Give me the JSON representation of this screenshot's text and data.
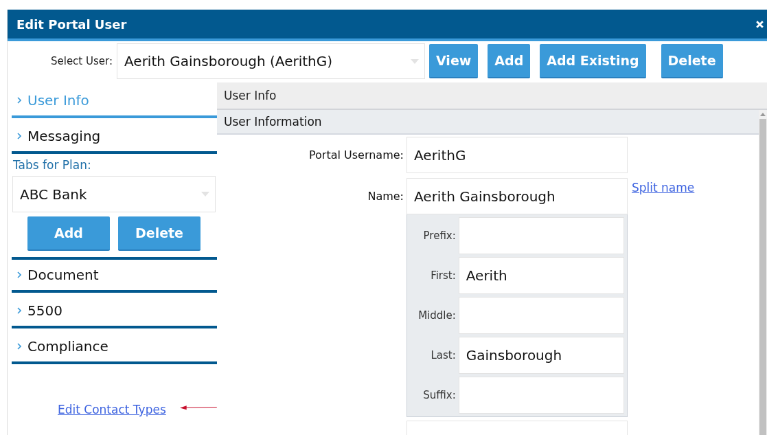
{
  "window": {
    "title": "Edit Portal User"
  },
  "user_select": {
    "label": "Select User:",
    "value": "Aerith Gainsborough (AerithG)"
  },
  "toolbar_buttons": [
    "View",
    "Add",
    "Add Existing",
    "Delete"
  ],
  "sidebar": {
    "top_items": [
      {
        "label": "User Info",
        "selected": true
      },
      {
        "label": "Messaging",
        "selected": false
      }
    ],
    "plan": {
      "label": "Tabs for Plan:",
      "value": "ABC Bank",
      "buttons": [
        "Add",
        "Delete"
      ]
    },
    "bottom_items": [
      {
        "label": "Document",
        "selected": false
      },
      {
        "label": "5500",
        "selected": false
      },
      {
        "label": "Compliance",
        "selected": false
      }
    ],
    "link": "Edit Contact Types"
  },
  "panel": {
    "breadcrumb": "User Info",
    "section_title": "User Information",
    "username": {
      "label": "Portal Username:",
      "value": "AerithG"
    },
    "name": {
      "label": "Name:",
      "value": "Aerith Gainsborough",
      "link": "Split name"
    },
    "name_parts": [
      {
        "label": "Prefix:"
      },
      {
        "label": "First:",
        "value": "Aerith"
      },
      {
        "label": "Middle:"
      },
      {
        "label": "Last:",
        "value": "Gainsborough"
      },
      {
        "label": "Suffix:"
      }
    ]
  }
}
